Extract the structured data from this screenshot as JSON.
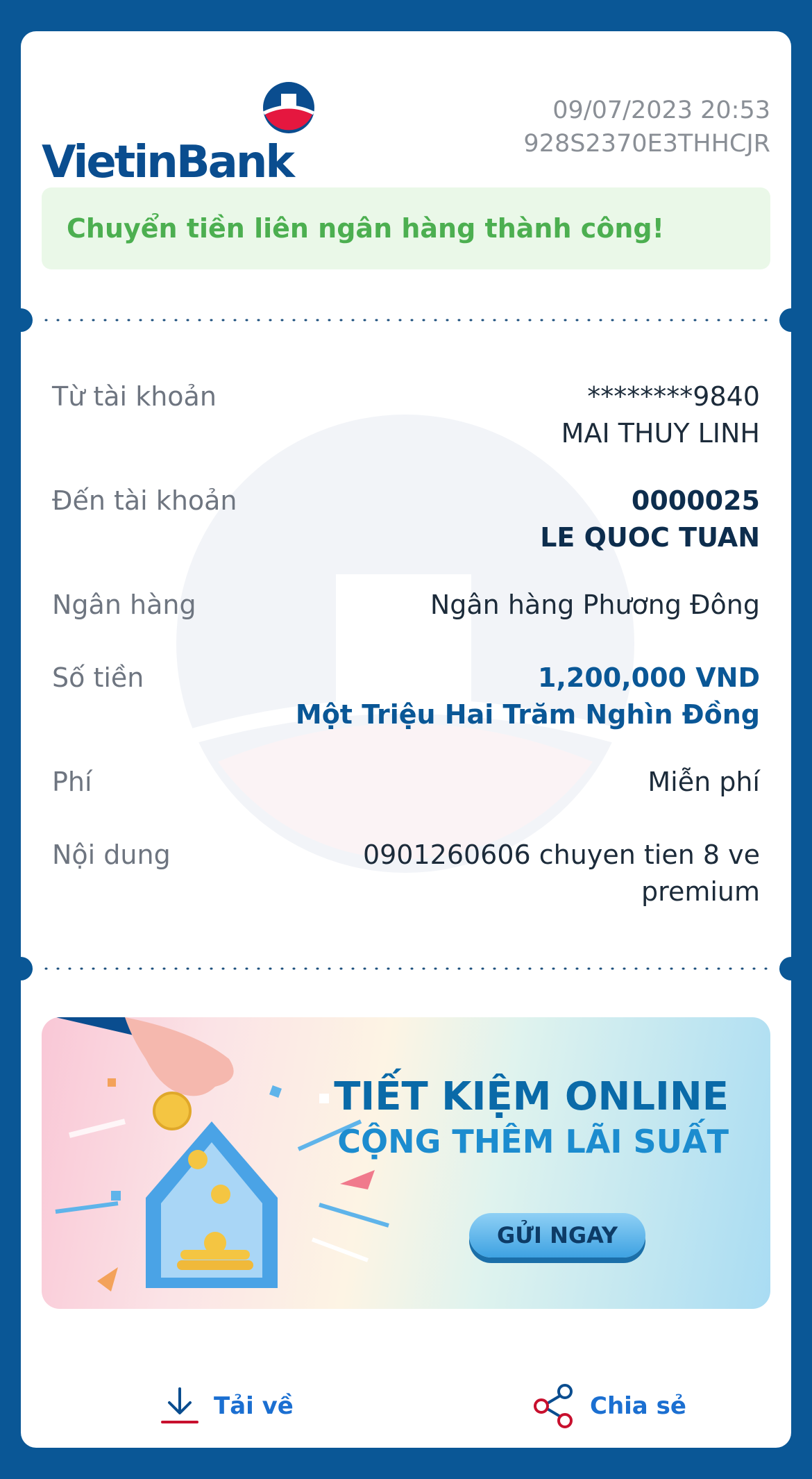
{
  "brand": {
    "name": "VietinBank",
    "color_primary": "#0a4d8f",
    "color_accent": "#e5173f"
  },
  "header": {
    "datetime": "09/07/2023 20:53",
    "reference": "928S2370E3THHCJR"
  },
  "status": {
    "message": "Chuyển tiền liên ngân hàng thành công!",
    "color": "#4caf50"
  },
  "details": [
    {
      "label": "Từ tài khoản",
      "lines": [
        "********9840",
        "MAI THUY LINH"
      ]
    },
    {
      "label": "Đến tài khoản",
      "lines": [
        "0000025",
        "LE QUOC TUAN"
      ]
    },
    {
      "label": "Ngân hàng",
      "lines": [
        "Ngân hàng Phương Đông"
      ]
    },
    {
      "label": "Số tiền",
      "lines": [
        "1,200,000 VND",
        "Một Triệu Hai Trăm Nghìn Đồng"
      ]
    },
    {
      "label": "Phí",
      "lines": [
        "Miễn phí"
      ]
    },
    {
      "label": "Nội dung",
      "lines": [
        "0901260606 chuyen tien 8 ve",
        "premium"
      ]
    }
  ],
  "promo": {
    "title_line1": "TIẾT KIỆM ONLINE",
    "title_line2": "CỘNG THÊM LÃI SUẤT",
    "cta_label": "GỬI NGAY"
  },
  "footer": {
    "download_label": "Tải về",
    "download_icon": "download-icon",
    "share_label": "Chia sẻ",
    "share_icon": "share-icon"
  }
}
